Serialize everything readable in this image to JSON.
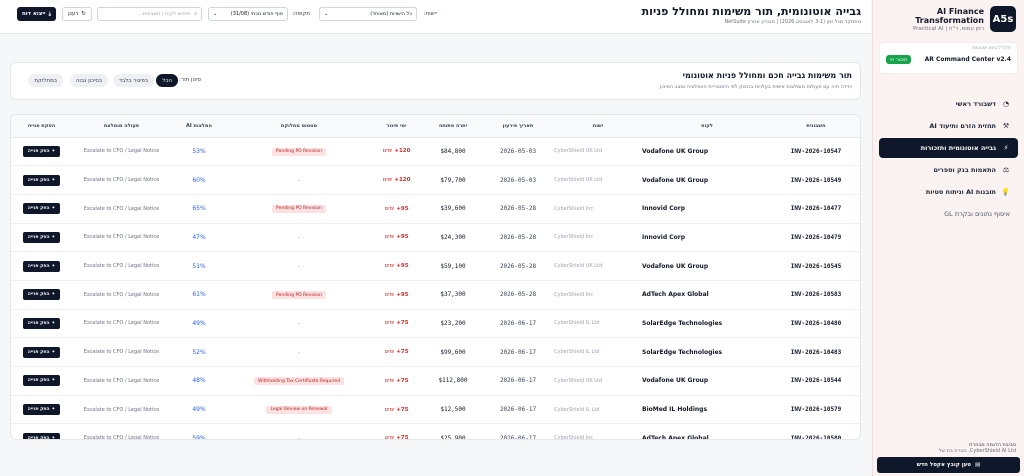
{
  "sidebar": {
    "logo": "A5s",
    "brand_title": "AI Finance Transformation",
    "brand_sub": "רמן עמוס, ר\"ח | Practical AI",
    "ar_card": {
      "status_label": "מלכ\"ל בזמן אוטומטי",
      "title": "AR Command Center v2.4",
      "badge": "חיבור חי"
    },
    "nav": [
      {
        "label": "דשבורד ראשי",
        "icon": "◔",
        "icon_name": "dashboard-icon"
      },
      {
        "label": "תחזית הזרם ותיעוד AI",
        "icon": "⚒",
        "icon_name": "tools-icon"
      },
      {
        "label": "גבייה אוטונומית ותזכורות",
        "icon": "⚡",
        "icon_name": "lightning-icon"
      },
      {
        "label": "התאמות בנק וספרים",
        "icon": "⚖",
        "icon_name": "scale-icon"
      },
      {
        "label": "תובנות AI וניתוח סטיות",
        "icon": "💡",
        "icon_name": "lightbulb-icon"
      },
      {
        "label": "איסוף נתונים ובקרת GL",
        "icon": "",
        "icon_name": ""
      }
    ],
    "footer_line1": "סביבת הדגמה מבוזרת",
    "footer_line2": "CyberShield AI Ltd. חברת בת של",
    "upload_label": "טען קובץ אקסל חדש"
  },
  "header": {
    "title": "גבייה אוטונומית, תור משימות ומחולל פניות",
    "subtitle": "מתמקד מגל זמן (3-1 לאוגוסט 2026) | סנכרון אחרון NetSuite",
    "entity_label": "יישות:",
    "entity_value": "כל הישויות (מאוחד)",
    "period_label": "תקופה:",
    "period_value": "סוף חודש נוכחי (31/08)",
    "search_placeholder": "חיפוש לקוח / חשבונית...",
    "refresh_label": "רענן",
    "export_label": "ייצוא דוח"
  },
  "queue": {
    "title": "תור משימות גבייה חכם ומחולל פניות אוטונומי",
    "subtitle": "יחידה חיה עם פעולות מומלצות אישית בעלויות בהינתן לפי היסטוריית האסלציה ומצב הסיכון",
    "filter_label": "סינון תור:",
    "chips": [
      "הכל",
      "בפיגור בלבד",
      "בסיכון גבוה",
      "במחלוקת"
    ]
  },
  "table": {
    "headers": [
      "חשבונית",
      "לקוח",
      "ישות",
      "תאריך פירעון",
      "יתרה פתוחה",
      "ימי פיגור",
      "סטטוס מחלוקת",
      "המלצות AI",
      "פעולה מומלצת",
      "הפקת פנייה"
    ],
    "days_unit": "ימים",
    "generate_label": "הפק פנייה",
    "rows": [
      {
        "invoice": "INV-2026-10547",
        "client": "Vodafone UK Group",
        "entity": "CyberShield UK Ltd",
        "due": "2026-05-03",
        "balance": "$84,800",
        "days": "120+",
        "dispute": "Pending PO Revision",
        "reco": "53%",
        "action": "Escalate to CFO / Legal Notice"
      },
      {
        "invoice": "INV-2026-10549",
        "client": "Vodafone UK Group",
        "entity": "CyberShield UK Ltd",
        "due": "2026-05-03",
        "balance": "$79,700",
        "days": "120+",
        "dispute": "-",
        "reco": "60%",
        "action": "Escalate to CFO / Legal Notice"
      },
      {
        "invoice": "INV-2026-10477",
        "client": "Innovid Corp",
        "entity": "CyberShield Inc",
        "due": "2026-05-28",
        "balance": "$39,600",
        "days": "95+",
        "dispute": "Pending PO Revision",
        "reco": "65%",
        "action": "Escalate to CFO / Legal Notice"
      },
      {
        "invoice": "INV-2026-10479",
        "client": "Innovid Corp",
        "entity": "CyberShield Inc",
        "due": "2026-05-28",
        "balance": "$24,300",
        "days": "95+",
        "dispute": "-",
        "reco": "47%",
        "action": "Escalate to CFO / Legal Notice"
      },
      {
        "invoice": "INV-2026-10545",
        "client": "Vodafone UK Group",
        "entity": "CyberShield UK Ltd",
        "due": "2026-05-28",
        "balance": "$59,100",
        "days": "95+",
        "dispute": "-",
        "reco": "51%",
        "action": "Escalate to CFO / Legal Notice"
      },
      {
        "invoice": "INV-2026-10583",
        "client": "AdTech Apex Global",
        "entity": "CyberShield Inc",
        "due": "2026-05-28",
        "balance": "$37,300",
        "days": "95+",
        "dispute": "Pending PO Revision",
        "reco": "61%",
        "action": "Escalate to CFO / Legal Notice"
      },
      {
        "invoice": "INV-2026-10480",
        "client": "SolarEdge Technologies",
        "entity": "CyberShield IL Ltd",
        "due": "2026-06-17",
        "balance": "$23,200",
        "days": "75+",
        "dispute": "-",
        "reco": "49%",
        "action": "Escalate to CFO / Legal Notice"
      },
      {
        "invoice": "INV-2026-10483",
        "client": "SolarEdge Technologies",
        "entity": "CyberShield IL Ltd",
        "due": "2026-06-17",
        "balance": "$99,600",
        "days": "75+",
        "dispute": "-",
        "reco": "52%",
        "action": "Escalate to CFO / Legal Notice"
      },
      {
        "invoice": "INV-2026-10544",
        "client": "Vodafone UK Group",
        "entity": "CyberShield UK Ltd",
        "due": "2026-06-17",
        "balance": "$112,800",
        "days": "75+",
        "dispute": "Withholding Tax Certificate Required",
        "reco": "48%",
        "action": "Escalate to CFO / Legal Notice"
      },
      {
        "invoice": "INV-2026-10579",
        "client": "BioMed IL Holdings",
        "entity": "CyberShield IL Ltd",
        "due": "2026-06-17",
        "balance": "$12,500",
        "days": "75+",
        "dispute": "Legal Review on Renewal",
        "reco": "49%",
        "action": "Escalate to CFO / Legal Notice"
      },
      {
        "invoice": "INV-2026-10580",
        "client": "AdTech Apex Global",
        "entity": "CyberShield Inc",
        "due": "2026-06-17",
        "balance": "$25,900",
        "days": "75+",
        "dispute": "-",
        "reco": "59%",
        "action": "Escalate to CFO / Legal Notice"
      }
    ]
  }
}
